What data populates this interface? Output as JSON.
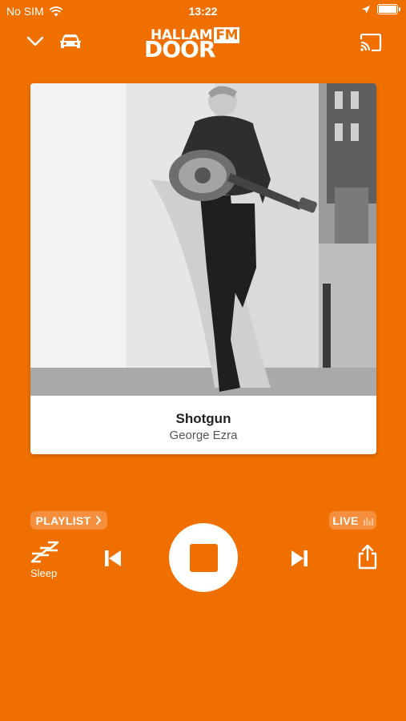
{
  "status_bar": {
    "carrier": "No SIM",
    "time": "13:22"
  },
  "header": {
    "logo_top": "HALLAM",
    "logo_fm": "FM",
    "logo_main": "DOOR"
  },
  "now_playing": {
    "title": "Shotgun",
    "artist": "George Ezra"
  },
  "pills": {
    "playlist": "PLAYLIST",
    "live": "LIVE"
  },
  "controls": {
    "sleep_label": "Sleep"
  },
  "colors": {
    "background": "#EF7000",
    "pill": "#F58F3E"
  }
}
